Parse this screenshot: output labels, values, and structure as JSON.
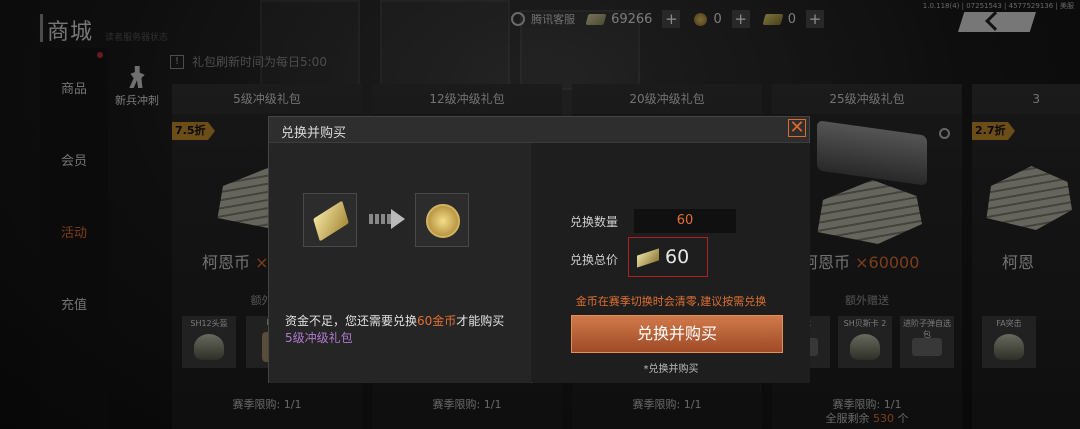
{
  "header": {
    "title": "商城",
    "subtitle": "读者服务器状态",
    "version": "1.0.118(4) | 07251543 | 4577529136 | 美服",
    "customer_service": "腾讯客服",
    "currency_bill_amount": "69266",
    "currency_coin_amount": "0",
    "currency_ticket_amount": "0",
    "plus_label": "+"
  },
  "sidebar": {
    "items": [
      {
        "label": "商品"
      },
      {
        "label": "会员"
      },
      {
        "label": "活动"
      },
      {
        "label": "充值"
      }
    ],
    "active_index": 2,
    "active_color": "#e07030"
  },
  "subtab": {
    "label": "新兵冲刺"
  },
  "notice": {
    "icon": "!",
    "text": "礼包刷新时间为每日5:00"
  },
  "cards": [
    {
      "title": "5级冲级礼包",
      "discount": "7.5折",
      "currency_label": "柯恩币",
      "currency_amount": "×",
      "bonus_label": "额外赠",
      "items": [
        "SH12头盔",
        "H L"
      ],
      "limit": "赛季限购: 1/1"
    },
    {
      "title": "12级冲级礼包",
      "limit": "赛季限购: 1/1"
    },
    {
      "title": "20级冲级礼包",
      "limit": "赛季限购: 1/1"
    },
    {
      "title": "25级冲级礼包",
      "currency_label": "柯恩币",
      "currency_amount": "×60000",
      "bonus_label": "额外赠送",
      "items": [
        "战术",
        "SH贝斯卡 2",
        "进阶子弹自选包"
      ],
      "limit": "赛季限购: 1/1",
      "stock_prefix": "全服剩余",
      "stock_num": "530",
      "stock_suffix": "个"
    },
    {
      "title": "3",
      "discount": "2.7折",
      "currency_label": "柯恩",
      "items": [
        "FA突击"
      ]
    }
  ],
  "modal": {
    "title": "兑换并购买",
    "close_label": "✕",
    "warn_prefix": "资金不足，您还需要兑换",
    "warn_highlight": "60金币",
    "warn_suffix": "才能购买",
    "gift_name": "5级冲级礼包",
    "qty_label": "兑换数量",
    "qty_value": "60",
    "total_label": "兑换总价",
    "total_value": "60",
    "reminder": "金币在赛季切换时会清零,建议按需兑换",
    "buy_label": "兑换并购买",
    "buy_hint": "*兑换并购买"
  },
  "colors": {
    "accent": "#e07030",
    "discount": "#c58a2a",
    "gift_purple": "#b07ad0",
    "button": "#b85a32"
  }
}
